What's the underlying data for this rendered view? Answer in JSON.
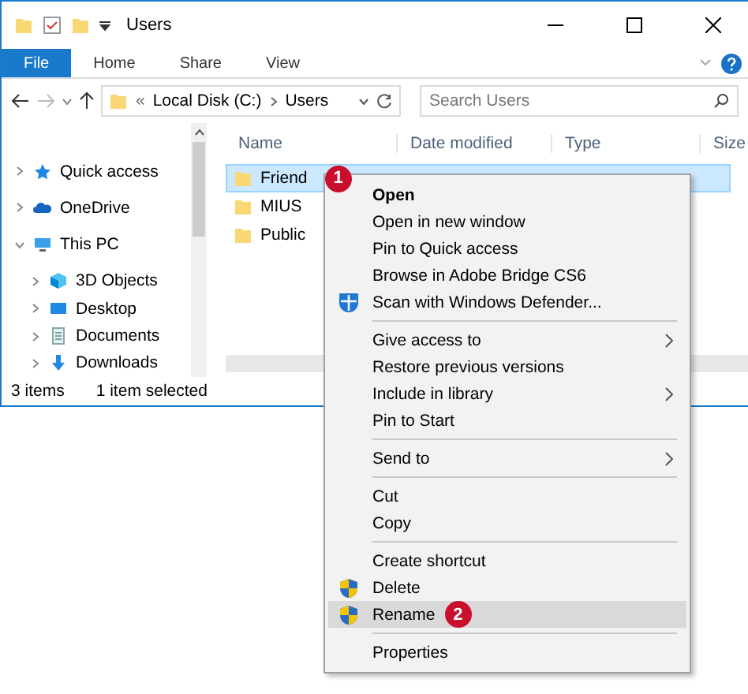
{
  "window": {
    "title": "Users"
  },
  "ribbon_tabs": [
    {
      "label": "File",
      "selected": true
    },
    {
      "label": "Home",
      "selected": false
    },
    {
      "label": "Share",
      "selected": false
    },
    {
      "label": "View",
      "selected": false
    }
  ],
  "address": {
    "overflow": "«",
    "crumbs": [
      "Local Disk (C:)",
      "Users"
    ]
  },
  "search": {
    "placeholder": "Search Users"
  },
  "sidebar": {
    "items": [
      {
        "label": "Quick access",
        "expanded": false
      },
      {
        "label": "OneDrive",
        "expanded": false
      },
      {
        "label": "This PC",
        "expanded": true,
        "children": [
          {
            "label": "3D Objects",
            "expanded": false
          },
          {
            "label": "Desktop",
            "expanded": false
          },
          {
            "label": "Documents",
            "expanded": false
          },
          {
            "label": "Downloads",
            "expanded": false
          }
        ]
      }
    ]
  },
  "table": {
    "columns": [
      "Name",
      "Date modified",
      "Type",
      "Size"
    ],
    "rows": [
      {
        "name": "Friend",
        "selected": true,
        "badge": "1"
      },
      {
        "name": "MIUS",
        "selected": false
      },
      {
        "name": "Public",
        "selected": false
      }
    ]
  },
  "status_bar": {
    "count": "3 items",
    "selection": "1 item selected"
  },
  "context_menu": [
    {
      "kind": "plain",
      "label": "Open",
      "bold": true
    },
    {
      "kind": "plain",
      "label": "Open in new window"
    },
    {
      "kind": "plain",
      "label": "Pin to Quick access"
    },
    {
      "kind": "plain",
      "label": "Browse in Adobe Bridge CS6"
    },
    {
      "kind": "scan",
      "label": "Scan with Windows Defender..."
    },
    {
      "kind": "separator"
    },
    {
      "kind": "plain",
      "label": "Give access to",
      "submenu": true
    },
    {
      "kind": "plain",
      "label": "Restore previous versions"
    },
    {
      "kind": "plain",
      "label": "Include in library",
      "submenu": true
    },
    {
      "kind": "plain",
      "label": "Pin to Start"
    },
    {
      "kind": "separator"
    },
    {
      "kind": "plain",
      "label": "Send to",
      "submenu": true
    },
    {
      "kind": "separator"
    },
    {
      "kind": "plain",
      "label": "Cut"
    },
    {
      "kind": "plain",
      "label": "Copy"
    },
    {
      "kind": "separator"
    },
    {
      "kind": "plain",
      "label": "Create shortcut"
    },
    {
      "kind": "admin",
      "label": "Delete"
    },
    {
      "kind": "admin",
      "label": "Rename",
      "selected": true,
      "badge": "2"
    },
    {
      "kind": "separator"
    },
    {
      "kind": "plain",
      "label": "Properties"
    }
  ]
}
